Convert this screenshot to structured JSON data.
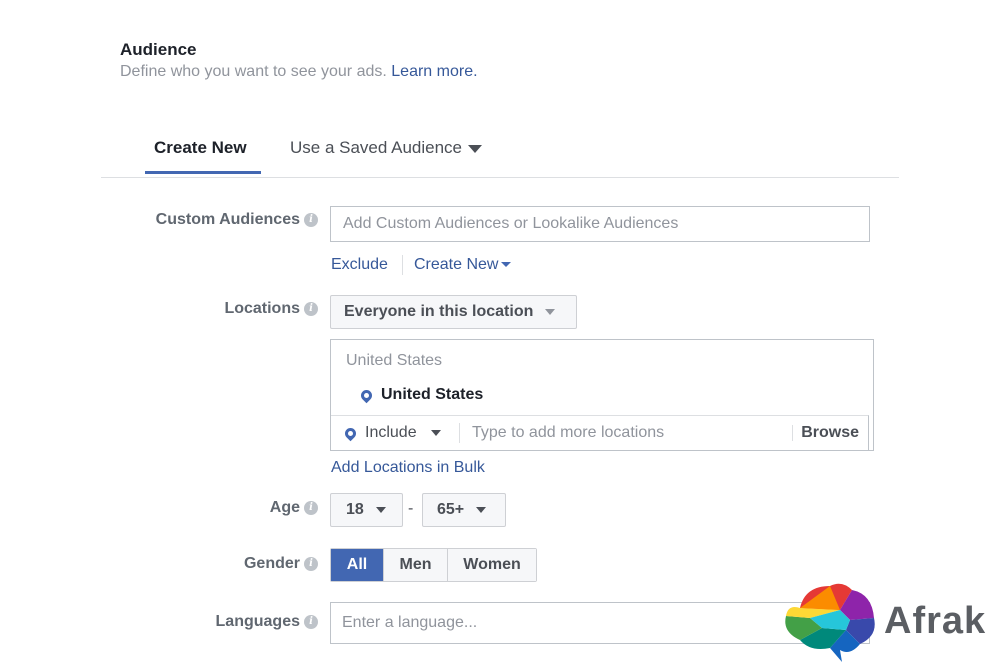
{
  "section": {
    "title": "Audience",
    "description": "Define who you want to see your ads.",
    "learn_more": "Learn more."
  },
  "tabs": [
    {
      "label": "Create New",
      "active": true
    },
    {
      "label": "Use a Saved Audience",
      "active": false
    }
  ],
  "custom_audiences": {
    "label": "Custom Audiences",
    "placeholder": "Add Custom Audiences or Lookalike Audiences",
    "exclude_label": "Exclude",
    "create_new_label": "Create New"
  },
  "locations": {
    "label": "Locations",
    "dropdown_value": "Everyone in this location",
    "group_header": "United States",
    "selected_item": "United States",
    "include_label": "Include",
    "add_placeholder": "Type to add more locations",
    "browse_label": "Browse",
    "bulk_link": "Add Locations in Bulk"
  },
  "age": {
    "label": "Age",
    "min": "18",
    "separator": "-",
    "max": "65+"
  },
  "gender": {
    "label": "Gender",
    "options": [
      "All",
      "Men",
      "Women"
    ],
    "selected": "All"
  },
  "languages": {
    "label": "Languages",
    "placeholder": "Enter a language..."
  },
  "watermark": {
    "text": "Afrak"
  },
  "colors": {
    "accent": "#4267b2",
    "link": "#365899",
    "muted_text": "#90949c",
    "label_text": "#606770"
  }
}
